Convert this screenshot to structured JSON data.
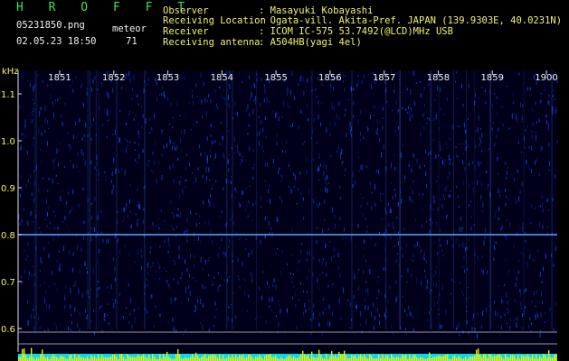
{
  "header": {
    "brand": "H R O F F T",
    "filename": "05231850.png",
    "timestamp": "02.05.23 18:50",
    "meteor_label": "meteor",
    "meteor_count": "71",
    "observer_label": "Observer",
    "observer_value": ": Masayuki Kobayashi",
    "location_label": "Receiving Location",
    "location_value": ": Ogata-vill. Akita-Pref. JAPAN (139.9303E, 40.0231N)",
    "receiver_label": "Receiver",
    "receiver_value": ": ICOM IC-575 53.7492(@LCD)MHz USB",
    "antenna_label": "Receiving antenna",
    "antenna_value": ": A504HB(yagi 4el)"
  },
  "chart_data": {
    "type": "heatmap",
    "ylabel": "kHz",
    "yticks": [
      "1.1",
      "1.0",
      "0.9",
      "0.8",
      "0.7",
      "0.6"
    ],
    "xticks": [
      "1851",
      "1852",
      "1853",
      "1854",
      "1855",
      "1856",
      "1857",
      "1858",
      "1859",
      "1900"
    ],
    "carrier_khz": 0.8,
    "colors": {
      "background": "#00001a",
      "signal": "#1e50ff",
      "carrier": "#5aa8ff",
      "level": "#f0f000",
      "level_base": "#00d8ff"
    }
  }
}
